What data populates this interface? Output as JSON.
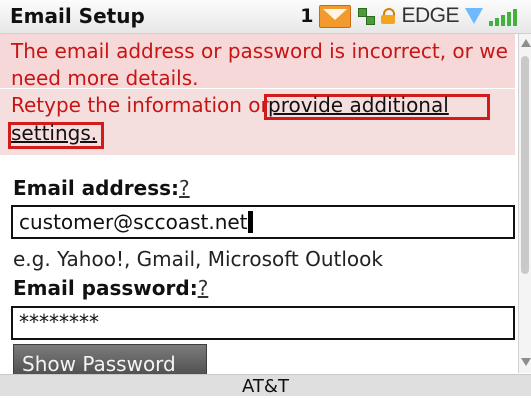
{
  "header": {
    "title": "Email Setup",
    "unread_count": "1",
    "network_label": "EDGE",
    "icons": [
      "envelope-icon",
      "network-icon",
      "lock-icon",
      "wifi-icon",
      "signal-strength-icon"
    ]
  },
  "error": {
    "message": "The email address or password is incorrect, or we need more details.",
    "retype_prefix": "Retype the information or ",
    "link_line1": "provide additional",
    "link_line2": "settings."
  },
  "form": {
    "email_label": "Email address:",
    "email_help": "?",
    "email_value": "customer@sccoast.net",
    "email_hint": "e.g. Yahoo!, Gmail, Microsoft Outlook",
    "password_label": "Email password:",
    "password_help": "?",
    "password_value": "********",
    "show_password_label": "Show Password"
  },
  "footer": {
    "carrier": "AT&T"
  },
  "colors": {
    "error_text": "#c71515",
    "error_background": "#f6d8d8",
    "button": "#5c5c5c"
  }
}
